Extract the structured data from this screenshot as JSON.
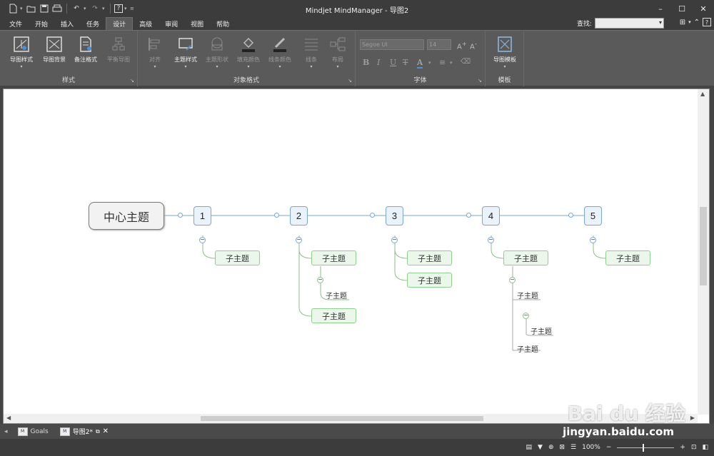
{
  "app": {
    "title": "Mindjet MindManager - 导图2"
  },
  "quick_access": [
    {
      "icon": "new-doc-icon"
    },
    {
      "icon": "open-icon"
    },
    {
      "icon": "save-icon"
    },
    {
      "icon": "print-icon"
    },
    {
      "icon": "undo-icon"
    },
    {
      "icon": "redo-icon"
    },
    {
      "icon": "help-icon"
    }
  ],
  "menu": {
    "tabs": [
      "文件",
      "开始",
      "插入",
      "任务",
      "设计",
      "高级",
      "审阅",
      "视图",
      "帮助"
    ],
    "active": "设计"
  },
  "find": {
    "label": "查找:",
    "value": ""
  },
  "ribbon": {
    "style_group": {
      "label": "样式",
      "buttons": [
        "导图样式",
        "导图背景",
        "备注格式",
        "平衡导图"
      ]
    },
    "object_group": {
      "label": "对象格式",
      "buttons": [
        "对齐",
        "主题样式",
        "主题形状",
        "填充颜色",
        "线条颜色",
        "线条",
        "布局"
      ]
    },
    "font_group": {
      "label": "字体",
      "font": "Segoe UI",
      "size": "14"
    },
    "template_group": {
      "label": "模板",
      "buttons": [
        "导图模板"
      ]
    }
  },
  "map": {
    "central": "中心主题",
    "mains": [
      "1",
      "2",
      "3",
      "4",
      "5"
    ],
    "subtopic_label": "子主题"
  },
  "doc_tabs": [
    {
      "label": "Goals"
    },
    {
      "label": "导图2*"
    }
  ],
  "status": {
    "zoom": "100%"
  },
  "watermark": {
    "text": "Bai du 经验",
    "url": "jingyan.baidu.com"
  }
}
